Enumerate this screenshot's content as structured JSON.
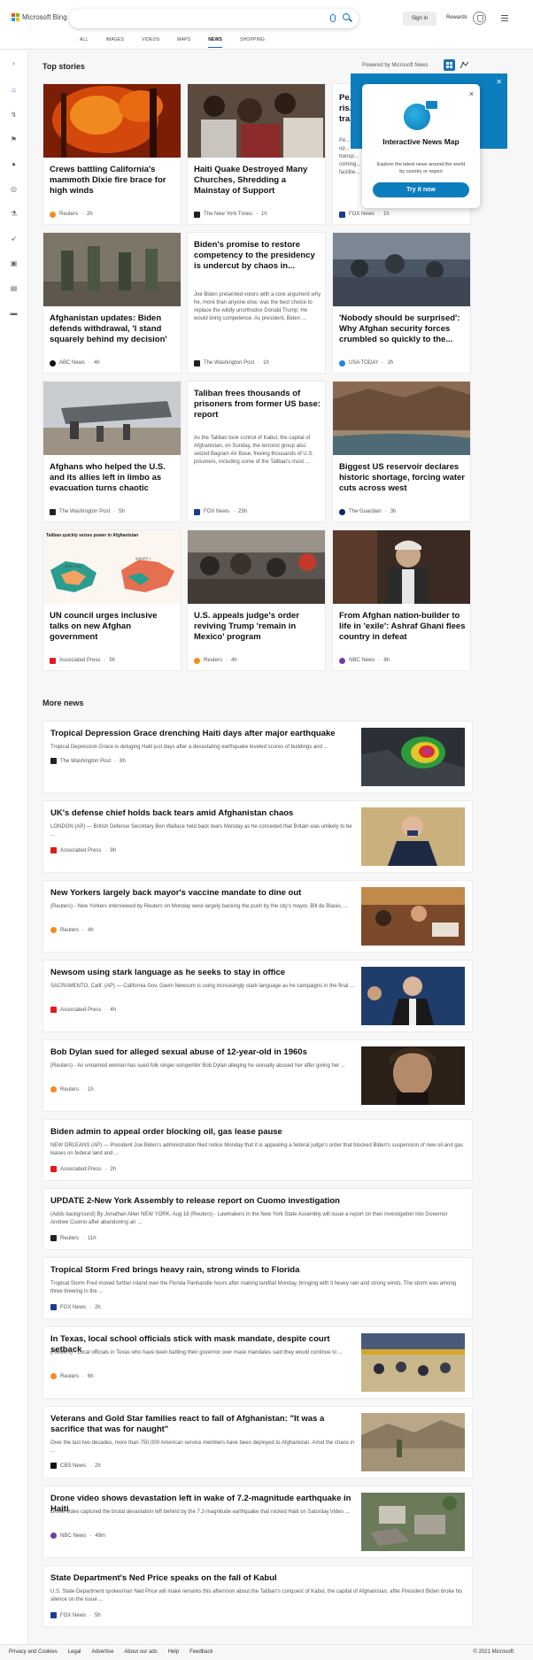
{
  "header": {
    "logo_text": "Microsoft Bing",
    "search_placeholder": "",
    "signin_label": "Sign in",
    "rewards_label": "Rewards",
    "tabs": [
      "ALL",
      "IMAGES",
      "VIDEOS",
      "MAPS",
      "NEWS",
      "SHOPPING"
    ],
    "active_tab": "NEWS"
  },
  "top_stories": {
    "title": "Top stories",
    "powered_by": "Powered by Microsoft News",
    "cards": [
      {
        "title": "Crews battling California's mammoth Dixie fire brace for high winds",
        "source": "Reuters",
        "age": "2h",
        "snippet": ""
      },
      {
        "title": "Haiti Quake Destroyed Many Churches, Shredding a Mainstay of Support",
        "source": "The New York Times",
        "age": "1h",
        "snippet": ""
      },
      {
        "title": "Pe... ris... tra...",
        "source": "FOX News",
        "age": "1h",
        "snippet": "Pe... that up... transp... coming... facilitie..."
      },
      {
        "title": "Afghanistan updates: Biden defends withdrawal, 'I stand squarely behind my decision'",
        "source": "ABC News",
        "age": "4h",
        "snippet": ""
      },
      {
        "title": "Biden's promise to restore competency to the presidency is undercut by chaos in...",
        "source": "The Washington Post",
        "age": "1h",
        "snippet": "Joe Biden presented voters with a core argument why he, more than anyone else, was the best choice to replace the wildly unorthodox Donald Trump: He would bring competence. As president, Biden ..."
      },
      {
        "title": "'Nobody should be surprised': Why Afghan security forces crumbled so quickly to the...",
        "source": "USA TODAY",
        "age": "2h",
        "snippet": ""
      },
      {
        "title": "Afghans who helped the U.S. and its allies left in limbo as evacuation turns chaotic",
        "source": "The Washington Post",
        "age": "5h",
        "snippet": ""
      },
      {
        "title": "Taliban frees thousands of prisoners from former US base: report",
        "source": "FOX News",
        "age": "23h",
        "snippet": "As the Taliban took control of Kabul, the capital of Afghanistan, on Sunday, the terrorist group also seized Bagram Air Base, freeing thousands of U.S. prisoners, including some of the Taliban's most ..."
      },
      {
        "title": "Biggest US reservoir declares historic shortage, forcing water cuts across west",
        "source": "The Guardian",
        "age": "3h",
        "snippet": ""
      },
      {
        "title": "UN council urges inclusive talks on new Afghan government",
        "source": "Associated Press",
        "age": "5h",
        "snippet": ""
      },
      {
        "title": "U.S. appeals judge's order reviving Trump 'remain in Mexico' program",
        "source": "Reuters",
        "age": "4h",
        "snippet": ""
      },
      {
        "title": "From Afghan nation-builder to life in 'exile': Ashraf Ghani flees country in defeat",
        "source": "NBC News",
        "age": "8h",
        "snippet": ""
      }
    ],
    "chart_card_title": "Taliban quickly seizes power in Afghanistan",
    "chart_card_dates": [
      "APRIL 2021",
      "AUGUST 1"
    ]
  },
  "popover": {
    "title": "Interactive News Map",
    "description": "Explore the latest news around the world by country or region",
    "button": "Try it now",
    "close": "×"
  },
  "more_news": {
    "title": "More news",
    "items": [
      {
        "title": "Tropical Depression Grace drenching Haiti days after major earthquake",
        "snippet": "Tropical Depression Grace is deluging Haiti just days after a devastating earthquake leveled scores of buildings and ...",
        "source": "The Washington Post",
        "age": "8h"
      },
      {
        "title": "UK's defense chief holds back tears amid Afghanistan chaos",
        "snippet": "LONDON (AP) — British Defense Secretary Ben Wallace held back tears Monday as he conceded that Britain was unlikely to be ...",
        "source": "Associated Press",
        "age": "9h"
      },
      {
        "title": "New Yorkers largely back mayor's vaccine mandate to dine out",
        "snippet": "(Reuters) - New Yorkers interviewed by Reuters on Monday were largely backing the push by the city's mayor, Bill de Blasio, ...",
        "source": "Reuters",
        "age": "4h"
      },
      {
        "title": "Newsom using stark language as he seeks to stay in office",
        "snippet": "SACRAMENTO, Calif. (AP) — California Gov. Gavin Newsom is using increasingly stark language as he campaigns in the final ...",
        "source": "Associated Press",
        "age": "4h"
      },
      {
        "title": "Bob Dylan sued for alleged sexual abuse of 12-year-old in 1960s",
        "snippet": "(Reuters) - An unnamed woman has sued folk singer-songwriter Bob Dylan alleging he sexually abused her after giving her ...",
        "source": "Reuters",
        "age": "1h"
      },
      {
        "title": "Biden admin to appeal order blocking oil, gas lease pause",
        "snippet": "NEW ORLEANS (AP) — President Joe Biden's administration filed notice Monday that it is appealing a federal judge's order that blocked Biden's suspension of new oil and gas leases on federal land and ...",
        "source": "Associated Press",
        "age": "2h"
      },
      {
        "title": "UPDATE 2-New York Assembly to release report on Cuomo investigation",
        "snippet": "(Adds background) By Jonathan Allen NEW YORK, Aug 16 (Reuters) - Lawmakers in the New York State Assembly will issue a report on their investigation into Governor Andrew Cuomo after abandoning an ...",
        "source": "Reuters",
        "age": "11h"
      },
      {
        "title": "Tropical Storm Fred brings heavy rain, strong winds to Florida",
        "snippet": "Tropical Storm Fred moved further inland over the Florida Panhandle hours after making landfall Monday, bringing with it heavy rain and strong winds. The storm was among three brewing in the ...",
        "source": "FOX News",
        "age": "2h"
      },
      {
        "title": "In Texas, local school officials stick with mask mandate, despite court setback",
        "snippet": "(Reuters) - Local officials in Texas who have been battling their governor over mask mandates said they would continue to ...",
        "source": "Reuters",
        "age": "6h"
      },
      {
        "title": "Veterans and Gold Star families react to fall of Afghanistan: \"It was a sacrifice that was for naught\"",
        "snippet": "Over the last two decades, more than 750,000 American service members have been deployed to Afghanistan. Amid the chaos in ...",
        "source": "CBS News",
        "age": "2h"
      },
      {
        "title": "Drone video shows devastation left in wake of 7.2-magnitude earthquake in Haiti",
        "snippet": "Drone video captured the brutal devastation left behind by the 7.2-magnitude earthquake that rocked Haiti on Saturday.Video ...",
        "source": "NBC News",
        "age": "49m"
      },
      {
        "title": "State Department's Ned Price speaks on the fall of Kabul",
        "snippet": "U.S. State Department spokesman Ned Price will make remarks this afternoon about the Taliban's conquest of Kabul, the capital of Afghanistan, after President Biden broke his silence on the issue ...",
        "source": "FOX News",
        "age": "5h"
      }
    ]
  },
  "footer": {
    "links": [
      "Privacy and Cookies",
      "Legal",
      "Advertise",
      "About our ads",
      "Help",
      "Feedback"
    ],
    "copyright": "© 2021 Microsoft"
  },
  "colors": {
    "accent": "#0e67b6",
    "popover": "#0c7ebd"
  }
}
